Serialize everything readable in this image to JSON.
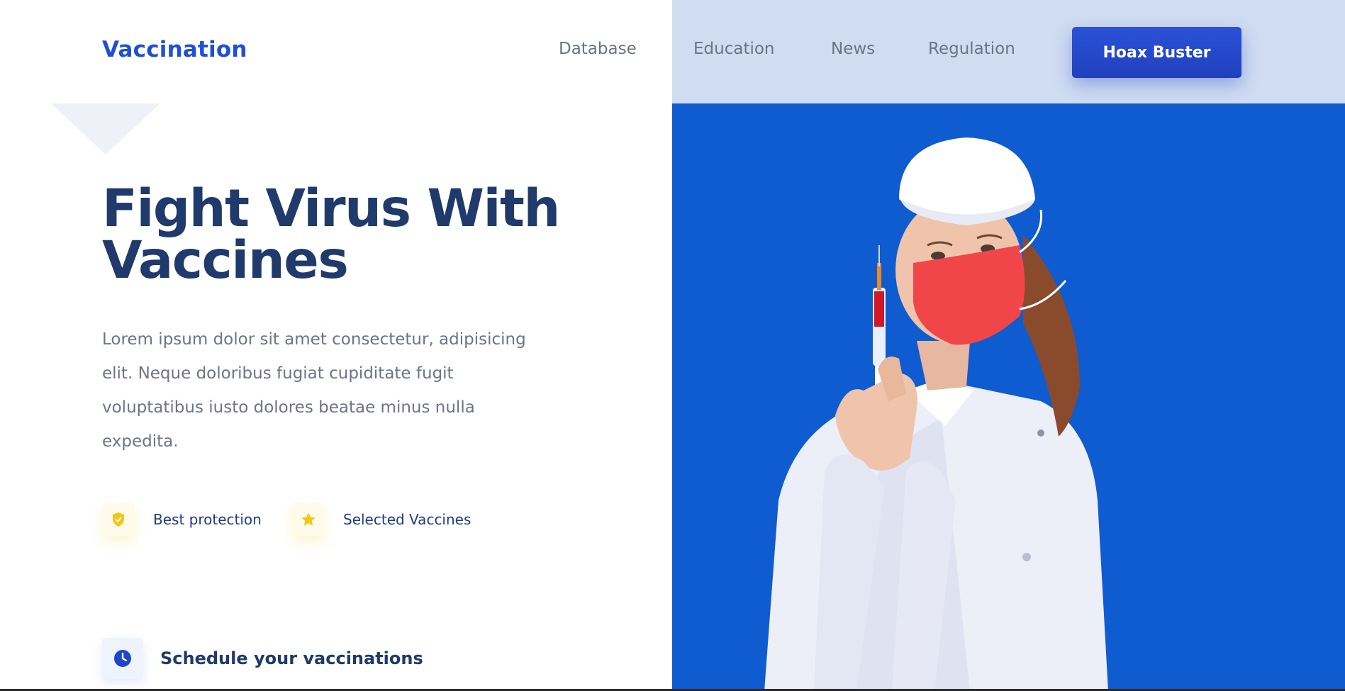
{
  "header": {
    "brand": "Vaccination",
    "nav": [
      {
        "label": "Database"
      },
      {
        "label": "Education"
      },
      {
        "label": "News"
      },
      {
        "label": "Regulation"
      }
    ],
    "cta_label": "Hoax Buster"
  },
  "hero": {
    "headline_line1": "Fight Virus With",
    "headline_line2": "Vaccines",
    "lead": "Lorem ipsum dolor sit amet consectetur, adipisicing elit. Neque doloribus fugiat cupiditate fugit voluptatibus iusto dolores beatae minus nulla expedita.",
    "features": [
      {
        "label": "Best protection",
        "icon": "shield-check-icon"
      },
      {
        "label": "Selected Vaccines",
        "icon": "star-icon"
      }
    ],
    "schedule_label": "Schedule your vaccinations",
    "schedule_icon": "clock-icon",
    "image": "nurse-with-syringe"
  },
  "colors": {
    "brand": "#1f4fd4",
    "cta": "#2140bf",
    "hero_panel": "#0f5bd0",
    "hero_panel_top": "#cfdcf1",
    "headline": "#1f3a6b",
    "feature_icon": "#f5c518"
  }
}
